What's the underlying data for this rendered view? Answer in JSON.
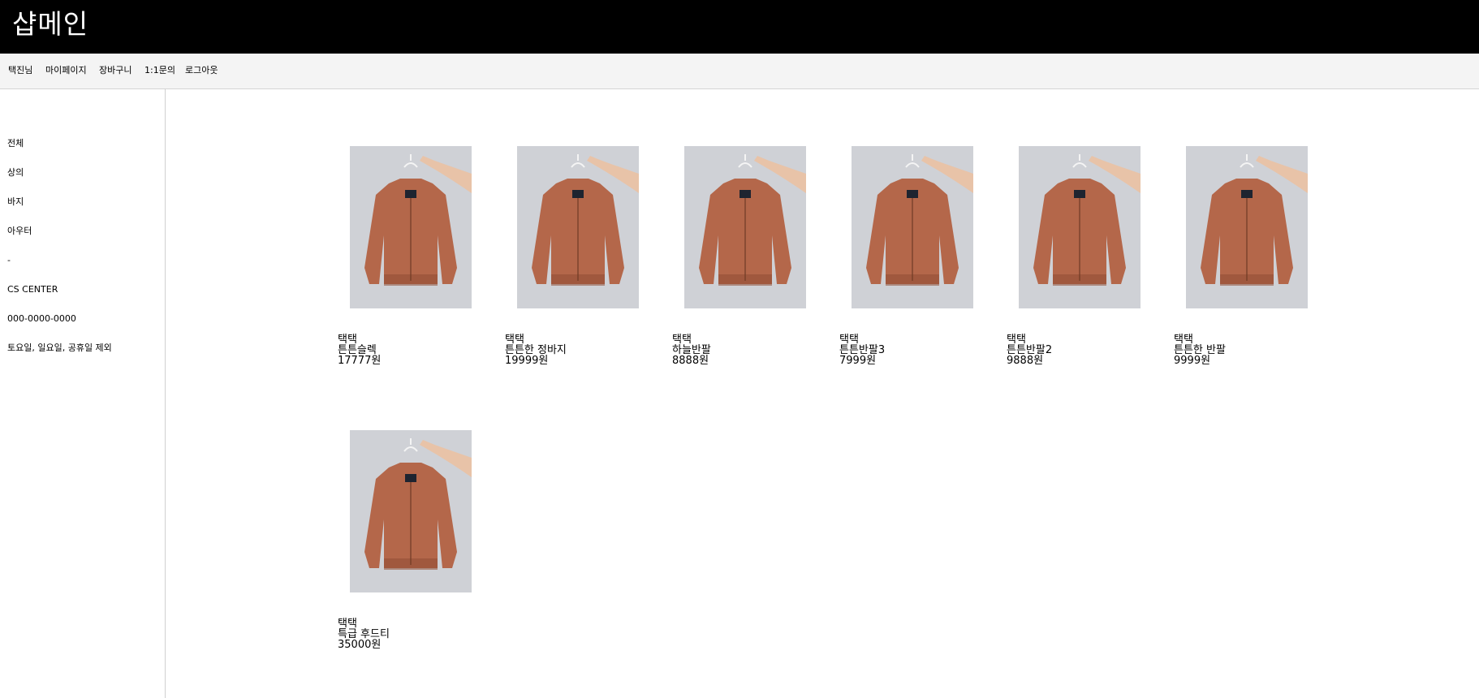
{
  "header": {
    "brand": "샵메인"
  },
  "nav": {
    "items": [
      {
        "label": "택진님"
      },
      {
        "label": "마이페이지"
      },
      {
        "label": "장바구니"
      },
      {
        "label": "1:1문의"
      },
      {
        "label": "로그아웃"
      }
    ]
  },
  "sidebar": {
    "categories": [
      "전체",
      "상의",
      "바지",
      "아우터"
    ],
    "divider": "-",
    "cs_title": "CS CENTER",
    "phone": "000-0000-0000",
    "closed_note": "토요일, 일요일, 공휴일 제외"
  },
  "products": [
    {
      "brand": "택택",
      "name": "튼튼슬렉",
      "price": "17777원"
    },
    {
      "brand": "택택",
      "name": "튼튼한 정바지",
      "price": "19999원"
    },
    {
      "brand": "택택",
      "name": "하늘반팔",
      "price": "8888원"
    },
    {
      "brand": "택택",
      "name": "튼튼반팔3",
      "price": "7999원"
    },
    {
      "brand": "택택",
      "name": "튼튼반팔2",
      "price": "9888원"
    },
    {
      "brand": "택택",
      "name": "튼튼한 반팔",
      "price": "9999원"
    },
    {
      "brand": "택택",
      "name": "특급 후드티",
      "price": "35000원"
    }
  ],
  "product_image": {
    "background": "#cfd1d6",
    "jacket_color": "#b4674a",
    "jacket_shadow": "#8f4c34",
    "collar_color": "#1e2430",
    "arm_color": "#e8c3a8",
    "icon": "bomber-jacket-on-hanger-photo"
  }
}
